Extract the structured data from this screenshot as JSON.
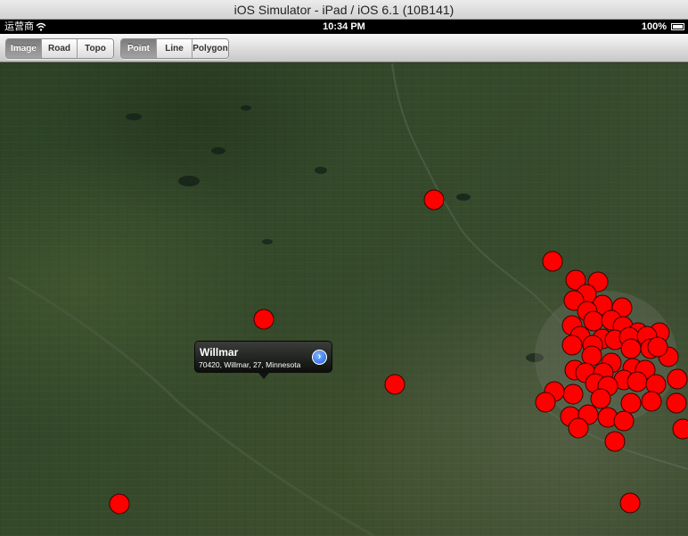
{
  "window": {
    "title": "iOS Simulator - iPad / iOS 6.1 (10B141)"
  },
  "status_bar": {
    "carrier": "运营商",
    "time": "10:34 PM",
    "battery": "100%"
  },
  "toolbar": {
    "basemap": {
      "options": [
        "Image",
        "Road",
        "Topo"
      ],
      "selected": "Image"
    },
    "geometry": {
      "options": [
        "Point",
        "Line",
        "Polygon"
      ],
      "selected": "Point"
    }
  },
  "map": {
    "marker_color": "#ff0000",
    "callout": {
      "title": "Willmar",
      "subtitle": "70420, Willmar, 27, Minnesota"
    }
  }
}
